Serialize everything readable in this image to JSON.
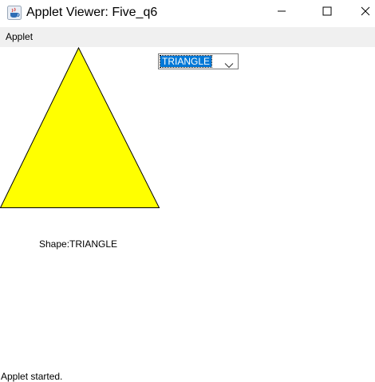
{
  "window": {
    "title": "Applet Viewer: Five_q6",
    "icon": "java-cup-icon",
    "controls": {
      "minimize_icon": "minimize-icon",
      "maximize_icon": "maximize-icon",
      "close_icon": "close-icon"
    }
  },
  "menubar": {
    "items": [
      {
        "label": "Applet"
      }
    ]
  },
  "applet": {
    "shape_selector": {
      "selected": "TRIANGLE",
      "icon": "chevron-down-icon"
    },
    "shape": {
      "type": "triangle",
      "fill_color": "#ffff00",
      "stroke_color": "#000000"
    },
    "shape_label": {
      "prefix": "Shape:",
      "value": "TRIANGLE"
    }
  },
  "status": {
    "text": "Applet started."
  }
}
